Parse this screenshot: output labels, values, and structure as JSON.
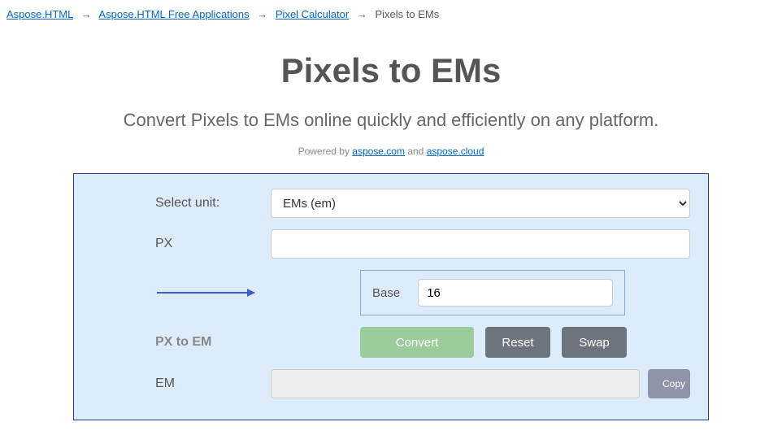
{
  "breadcrumb": {
    "items": [
      {
        "label": "Aspose.HTML",
        "link": true
      },
      {
        "label": "Aspose.HTML Free Applications",
        "link": true
      },
      {
        "label": "Pixel Calculator",
        "link": true
      },
      {
        "label": "Pixels to EMs",
        "link": false
      }
    ]
  },
  "hero": {
    "title": "Pixels to EMs",
    "subtitle": "Convert Pixels to EMs online quickly and efficiently on any platform.",
    "powered_prefix": "Powered by ",
    "powered_link1": "aspose.com",
    "powered_and": " and ",
    "powered_link2": "aspose.cloud"
  },
  "form": {
    "select_unit_label": "Select unit:",
    "select_unit_value": "EMs (em)",
    "px_label": "PX",
    "px_value": "",
    "base_label": "Base",
    "base_value": "16",
    "direction_label": "PX to EM",
    "convert_label": "Convert",
    "reset_label": "Reset",
    "swap_label": "Swap",
    "em_label": "EM",
    "em_value": "",
    "copy_label": "Copy"
  }
}
